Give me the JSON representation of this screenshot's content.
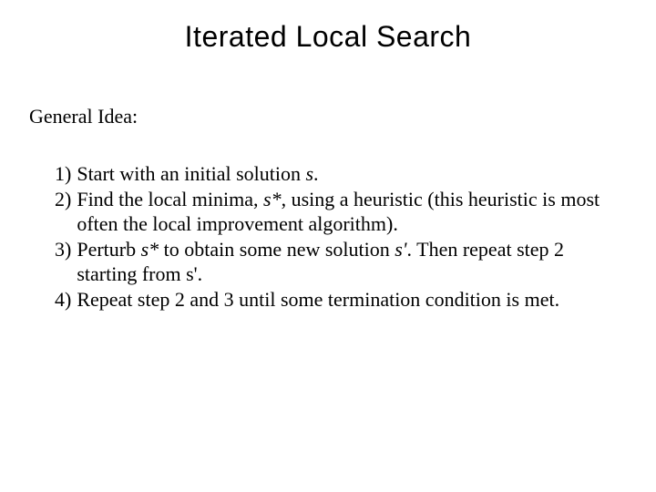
{
  "title": "Iterated Local Search",
  "section_heading": "General Idea:",
  "steps": [
    {
      "num": "1)",
      "pre": "Start with an initial solution ",
      "var": "s",
      "post": "."
    },
    {
      "num": "2)",
      "pre": "Find the local minima, ",
      "var": "s*",
      "post": ", using a heuristic (this heuristic is most often the local improvement algorithm)."
    },
    {
      "num": "3)",
      "pre": "Perturb ",
      "var": "s*",
      "mid": "  to obtain some new solution ",
      "var2": "s'",
      "post": ".  Then repeat step 2 starting from s'."
    },
    {
      "num": "4)",
      "pre": "Repeat step 2 and 3 until some termination condition is met.",
      "var": "",
      "post": ""
    }
  ]
}
